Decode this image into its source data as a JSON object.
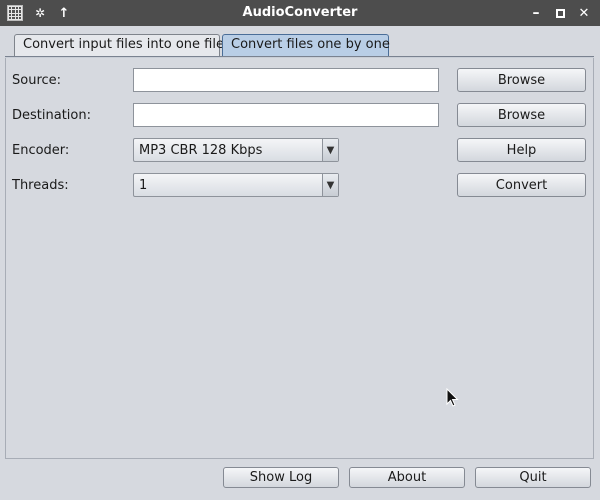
{
  "window": {
    "title": "AudioConverter"
  },
  "tabs": [
    {
      "label": "Convert input files into one file",
      "selected": false
    },
    {
      "label": "Convert files one by one",
      "selected": true
    }
  ],
  "form": {
    "source": {
      "label": "Source:",
      "value": "",
      "button": "Browse"
    },
    "destination": {
      "label": "Destination:",
      "value": "",
      "button": "Browse"
    },
    "encoder": {
      "label": "Encoder:",
      "value": "MP3 CBR 128 Kbps",
      "button": "Help"
    },
    "threads": {
      "label": "Threads:",
      "value": "1",
      "button": "Convert"
    }
  },
  "footer": {
    "show_log": "Show Log",
    "about": "About",
    "quit": "Quit"
  },
  "colors": {
    "titlebar": "#4d4d4d",
    "selected_tab": "#b9cee6",
    "background": "#d6d9df"
  }
}
